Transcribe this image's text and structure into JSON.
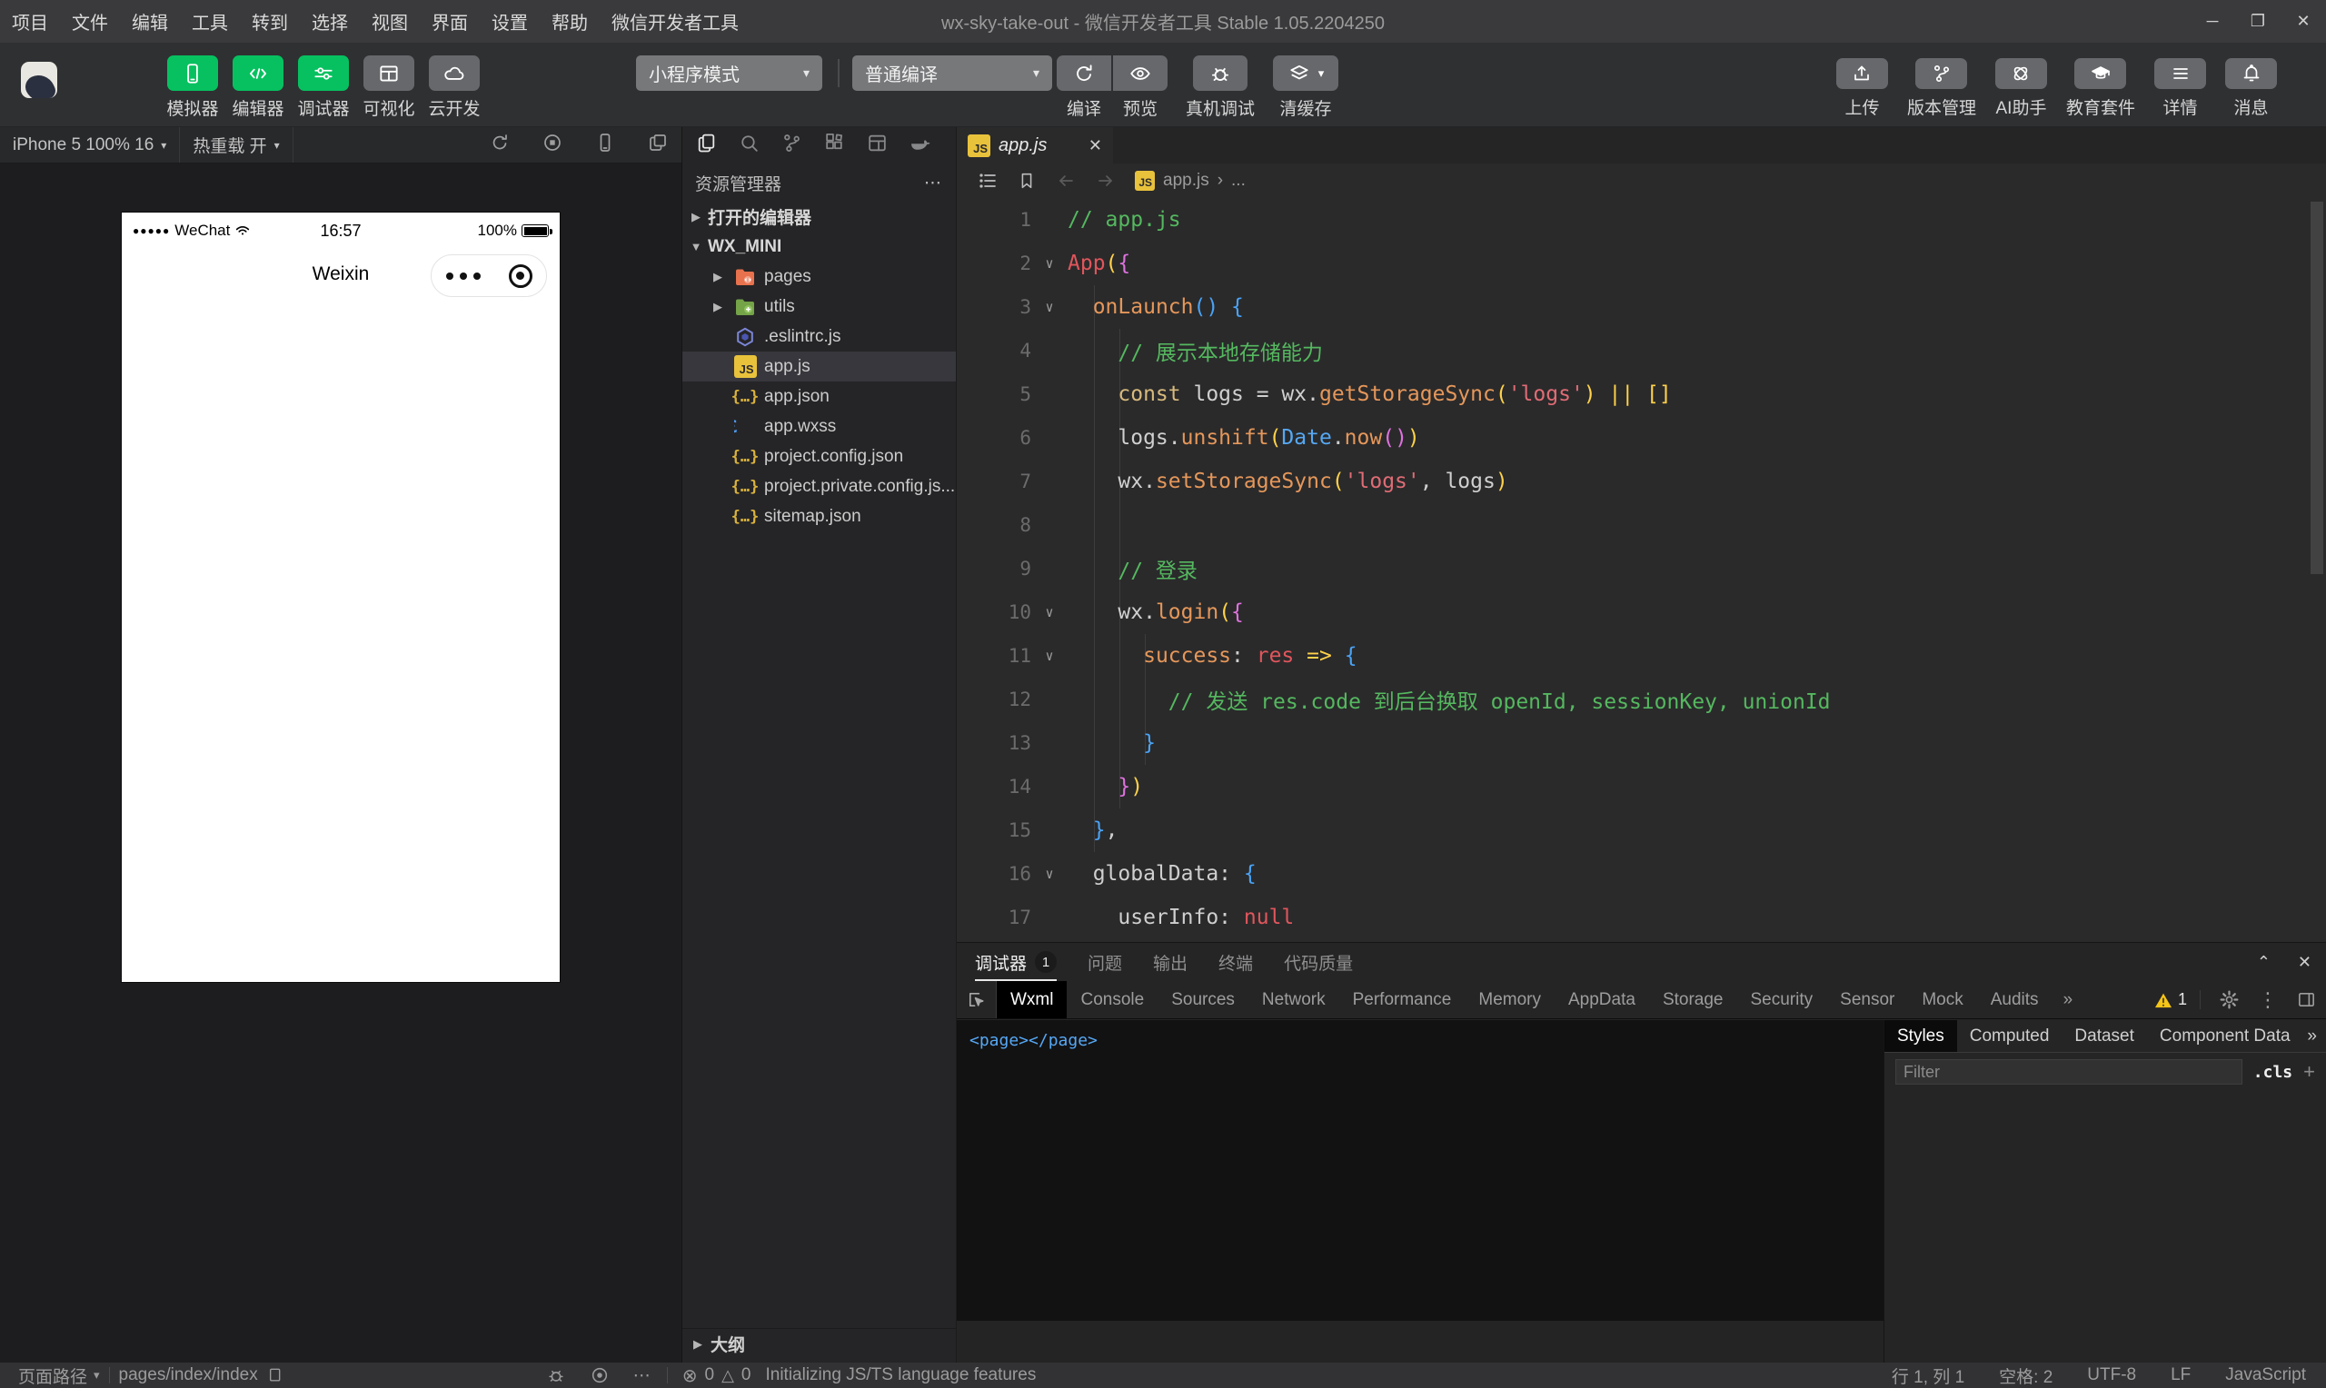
{
  "titlebar": {
    "menus": [
      "项目",
      "文件",
      "编辑",
      "工具",
      "转到",
      "选择",
      "视图",
      "界面",
      "设置",
      "帮助",
      "微信开发者工具"
    ],
    "title": "wx-sky-take-out - 微信开发者工具 Stable 1.05.2204250",
    "window_controls": [
      {
        "name": "minimize",
        "glyph": "─"
      },
      {
        "name": "maximize",
        "glyph": "❐"
      },
      {
        "name": "close",
        "glyph": "✕"
      }
    ]
  },
  "toolbar": {
    "mode_buttons": [
      {
        "label": "模拟器",
        "icon": "phone-icon",
        "style": "green"
      },
      {
        "label": "编辑器",
        "icon": "code-icon",
        "style": "green"
      },
      {
        "label": "调试器",
        "icon": "sliders-icon",
        "style": "green"
      },
      {
        "label": "可视化",
        "icon": "panes-icon",
        "style": "gray"
      },
      {
        "label": "云开发",
        "icon": "cloud-icon",
        "style": "gray"
      }
    ],
    "mode_dropdown": "小程序模式",
    "compile_dropdown": "普通编译",
    "compile_actions": [
      {
        "label": "编译",
        "icon": "refresh-icon",
        "caret": false
      },
      {
        "label": "预览",
        "icon": "eye-icon",
        "caret": false
      },
      {
        "label": "真机调试",
        "icon": "bug-icon",
        "caret": false
      },
      {
        "label": "清缓存",
        "icon": "layers-icon",
        "caret": true
      }
    ],
    "right_actions": [
      {
        "label": "上传",
        "icon": "upload-icon"
      },
      {
        "label": "版本管理",
        "icon": "branch-icon"
      },
      {
        "label": "AI助手",
        "icon": "knot-icon"
      },
      {
        "label": "教育套件",
        "icon": "grad-cap-icon"
      },
      {
        "label": "详情",
        "icon": "hamburger-icon"
      },
      {
        "label": "消息",
        "icon": "bell-icon"
      }
    ],
    "accent_green": "#07c160"
  },
  "simulator": {
    "device_label": "iPhone 5 100% 16",
    "hot_reload_label": "热重载 开",
    "header_icons": [
      "refresh-icon",
      "record-icon",
      "phone-icon",
      "windows-icon"
    ],
    "phone": {
      "signal_dots": "●●●●●",
      "carrier": "WeChat",
      "time": "16:57",
      "battery": "100%",
      "nav_title": "Weixin"
    }
  },
  "explorer": {
    "activity_icons": [
      "files-icon",
      "search-icon",
      "branch-icon",
      "extensions-icon",
      "layout-icon",
      "docker-icon"
    ],
    "title": "资源管理器",
    "more": "⋯",
    "open_editors_label": "打开的编辑器",
    "root_label": "WX_MINI",
    "files": [
      {
        "name": "pages",
        "icon": "folder-pages",
        "arrow": true,
        "selected": false
      },
      {
        "name": "utils",
        "icon": "folder-utils",
        "arrow": true,
        "selected": false
      },
      {
        "name": ".eslintrc.js",
        "icon": "eslint",
        "arrow": false,
        "selected": false
      },
      {
        "name": "app.js",
        "icon": "js",
        "arrow": false,
        "selected": true
      },
      {
        "name": "app.json",
        "icon": "braces",
        "arrow": false,
        "selected": false
      },
      {
        "name": "app.wxss",
        "icon": "wxss",
        "arrow": false,
        "selected": false
      },
      {
        "name": "project.config.json",
        "icon": "braces",
        "arrow": false,
        "selected": false
      },
      {
        "name": "project.private.config.js...",
        "icon": "braces",
        "arrow": false,
        "selected": false
      },
      {
        "name": "sitemap.json",
        "icon": "braces",
        "arrow": false,
        "selected": false
      }
    ],
    "outline_label": "大纲"
  },
  "editor": {
    "tab_label": "app.js",
    "tab_close": "✕",
    "breadcrumb_file": "app.js",
    "breadcrumb_sep": "›",
    "breadcrumb_more": "...",
    "fold_lines": [
      2,
      3,
      10,
      11,
      16
    ],
    "lines": [
      {
        "n": "1",
        "tokens": [
          [
            "cm",
            "// app.js"
          ]
        ]
      },
      {
        "n": "2",
        "tokens": [
          [
            "red",
            "App"
          ],
          [
            "g1",
            "("
          ],
          [
            "g2",
            "{"
          ]
        ]
      },
      {
        "n": "3",
        "tokens": [
          [
            "pl",
            "  "
          ],
          [
            "fn",
            "onLaunch"
          ],
          [
            "g3",
            "()"
          ],
          [
            "pl",
            " "
          ],
          [
            "g3",
            "{"
          ]
        ]
      },
      {
        "n": "4",
        "tokens": [
          [
            "pl",
            "    "
          ],
          [
            "cm",
            "// 展示本地存储能力"
          ]
        ]
      },
      {
        "n": "5",
        "tokens": [
          [
            "pl",
            "    "
          ],
          [
            "kw",
            "const"
          ],
          [
            "pl",
            " logs = wx."
          ],
          [
            "fn",
            "getStorageSync"
          ],
          [
            "g1",
            "("
          ],
          [
            "str",
            "'logs'"
          ],
          [
            "g1",
            ")"
          ],
          [
            "pl",
            " "
          ],
          [
            "g1",
            "|| []"
          ]
        ]
      },
      {
        "n": "6",
        "tokens": [
          [
            "pl",
            "    logs."
          ],
          [
            "fn",
            "unshift"
          ],
          [
            "g1",
            "("
          ],
          [
            "blu",
            "Date"
          ],
          [
            "pl",
            "."
          ],
          [
            "fn",
            "now"
          ],
          [
            "g2",
            "()"
          ],
          [
            "g1",
            ")"
          ]
        ]
      },
      {
        "n": "7",
        "tokens": [
          [
            "pl",
            "    wx."
          ],
          [
            "fn",
            "setStorageSync"
          ],
          [
            "g1",
            "("
          ],
          [
            "str",
            "'logs'"
          ],
          [
            "pl",
            ", logs"
          ],
          [
            "g1",
            ")"
          ]
        ]
      },
      {
        "n": "8",
        "tokens": []
      },
      {
        "n": "9",
        "tokens": [
          [
            "pl",
            "    "
          ],
          [
            "cm",
            "// 登录"
          ]
        ]
      },
      {
        "n": "10",
        "tokens": [
          [
            "pl",
            "    wx."
          ],
          [
            "fn",
            "login"
          ],
          [
            "g1",
            "("
          ],
          [
            "g2",
            "{"
          ]
        ]
      },
      {
        "n": "11",
        "tokens": [
          [
            "pl",
            "      "
          ],
          [
            "fn",
            "success"
          ],
          [
            "pl",
            ": "
          ],
          [
            "red",
            "res"
          ],
          [
            "pl",
            " "
          ],
          [
            "g1",
            "=>"
          ],
          [
            "pl",
            " "
          ],
          [
            "g3",
            "{"
          ]
        ]
      },
      {
        "n": "12",
        "tokens": [
          [
            "pl",
            "        "
          ],
          [
            "cm",
            "// 发送 res.code 到后台换取 openId, sessionKey, unionId"
          ]
        ]
      },
      {
        "n": "13",
        "tokens": [
          [
            "pl",
            "      "
          ],
          [
            "g3",
            "}"
          ]
        ]
      },
      {
        "n": "14",
        "tokens": [
          [
            "pl",
            "    "
          ],
          [
            "g2",
            "}"
          ],
          [
            "g1",
            ")"
          ]
        ]
      },
      {
        "n": "15",
        "tokens": [
          [
            "pl",
            "  "
          ],
          [
            "g3",
            "}"
          ],
          [
            "pl",
            ","
          ]
        ]
      },
      {
        "n": "16",
        "tokens": [
          [
            "pl",
            "  globalData: "
          ],
          [
            "g3",
            "{"
          ]
        ]
      },
      {
        "n": "17",
        "tokens": [
          [
            "pl",
            "    userInfo: "
          ],
          [
            "red",
            "null"
          ]
        ]
      }
    ]
  },
  "debug": {
    "panel_tabs": [
      {
        "label": "调试器",
        "badge": "1",
        "active": true
      },
      {
        "label": "问题",
        "active": false
      },
      {
        "label": "输出",
        "active": false
      },
      {
        "label": "终端",
        "active": false
      },
      {
        "label": "代码质量",
        "active": false
      }
    ],
    "collapse_glyph": "⌃",
    "close_glyph": "✕",
    "devtools_tabs": [
      {
        "label": "Wxml",
        "active": true
      },
      {
        "label": "Console",
        "active": false
      },
      {
        "label": "Sources",
        "active": false
      },
      {
        "label": "Network",
        "active": false
      },
      {
        "label": "Performance",
        "active": false
      },
      {
        "label": "Memory",
        "active": false
      },
      {
        "label": "AppData",
        "active": false
      },
      {
        "label": "Storage",
        "active": false
      },
      {
        "label": "Security",
        "active": false
      },
      {
        "label": "Sensor",
        "active": false
      },
      {
        "label": "Mock",
        "active": false
      },
      {
        "label": "Audits",
        "active": false
      }
    ],
    "overflow_glyph": "»",
    "warning_count": "1",
    "kebab_glyph": "⋮",
    "wxml_content": "<page></page>",
    "style_tabs": [
      {
        "label": "Styles",
        "active": true
      },
      {
        "label": "Computed",
        "active": false
      },
      {
        "label": "Dataset",
        "active": false
      },
      {
        "label": "Component Data",
        "active": false
      }
    ],
    "style_overflow": "»",
    "filter_placeholder": "Filter",
    "cls_label": ".cls",
    "plus_label": "+",
    "warning_yellow": "#f5c518"
  },
  "statusbar": {
    "page_path_label": "页面路径",
    "caret": "▾",
    "page_path_value": "pages/index/index",
    "error_glyph": "⊗",
    "error_count": "0",
    "warn_glyph": "△",
    "warn_count": "0",
    "message": "Initializing JS/TS language features",
    "right_items": [
      "行 1, 列 1",
      "空格: 2",
      "UTF-8",
      "LF",
      "JavaScript"
    ]
  }
}
